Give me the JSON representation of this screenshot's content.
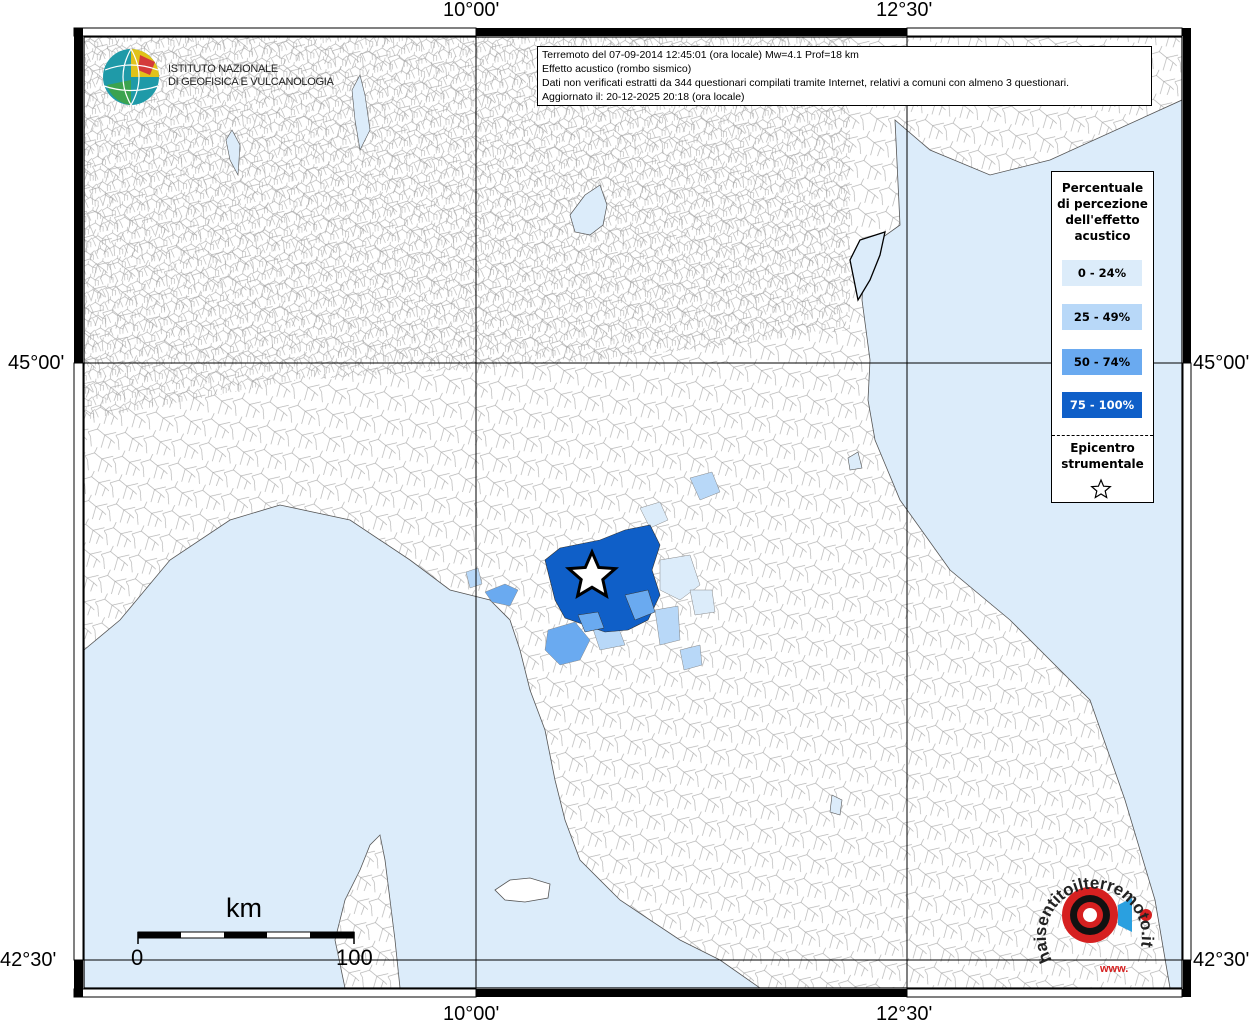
{
  "header_coords": {
    "top_left": "10°00'",
    "top_right": "12°30'",
    "bottom_left": "10°00'",
    "bottom_right": "12°30'",
    "left_upper": "45°00'",
    "left_lower": "42°30'",
    "right_upper": "45°00'",
    "right_lower": "42°30'"
  },
  "info_box": {
    "line1": "Terremoto del 07-09-2014 12:45:01 (ora locale) Mw=4.1 Prof=18 km",
    "line2": "Effetto acustico (rombo sismico)",
    "line3": "Dati non verificati estratti da 344 questionari compilati tramite Internet, relativi a comuni con almeno 3 questionari.",
    "line4": "Aggiornato il: 20-12-2025 20:18 (ora locale)"
  },
  "logo": {
    "line1": "ISTITUTO NAZIONALE",
    "line2": "DI GEOFISICA E VULCANOLOGIA"
  },
  "legend": {
    "title_line1": "Percentuale",
    "title_line2": "di percezione",
    "title_line3": "dell'effetto",
    "title_line4": "acustico",
    "classes": [
      {
        "label": "0 - 24%",
        "color": "#dcecfa",
        "text_color": "#000000"
      },
      {
        "label": "25 - 49%",
        "color": "#b8d8f8",
        "text_color": "#000000"
      },
      {
        "label": "50 - 74%",
        "color": "#6aaaf0",
        "text_color": "#000000"
      },
      {
        "label": "75 - 100%",
        "color": "#0f5fc8",
        "text_color": "#ffffff"
      }
    ],
    "epicenter_line1": "Epicentro",
    "epicenter_line2": "strumentale"
  },
  "scale": {
    "unit": "km",
    "min": "0",
    "max": "100"
  },
  "badge": {
    "text": "haisentitoilterremoto.it",
    "www": "www."
  },
  "colors": {
    "sea": "#dcecfa",
    "land": "#ffffff",
    "border": "#9a9a9a"
  }
}
